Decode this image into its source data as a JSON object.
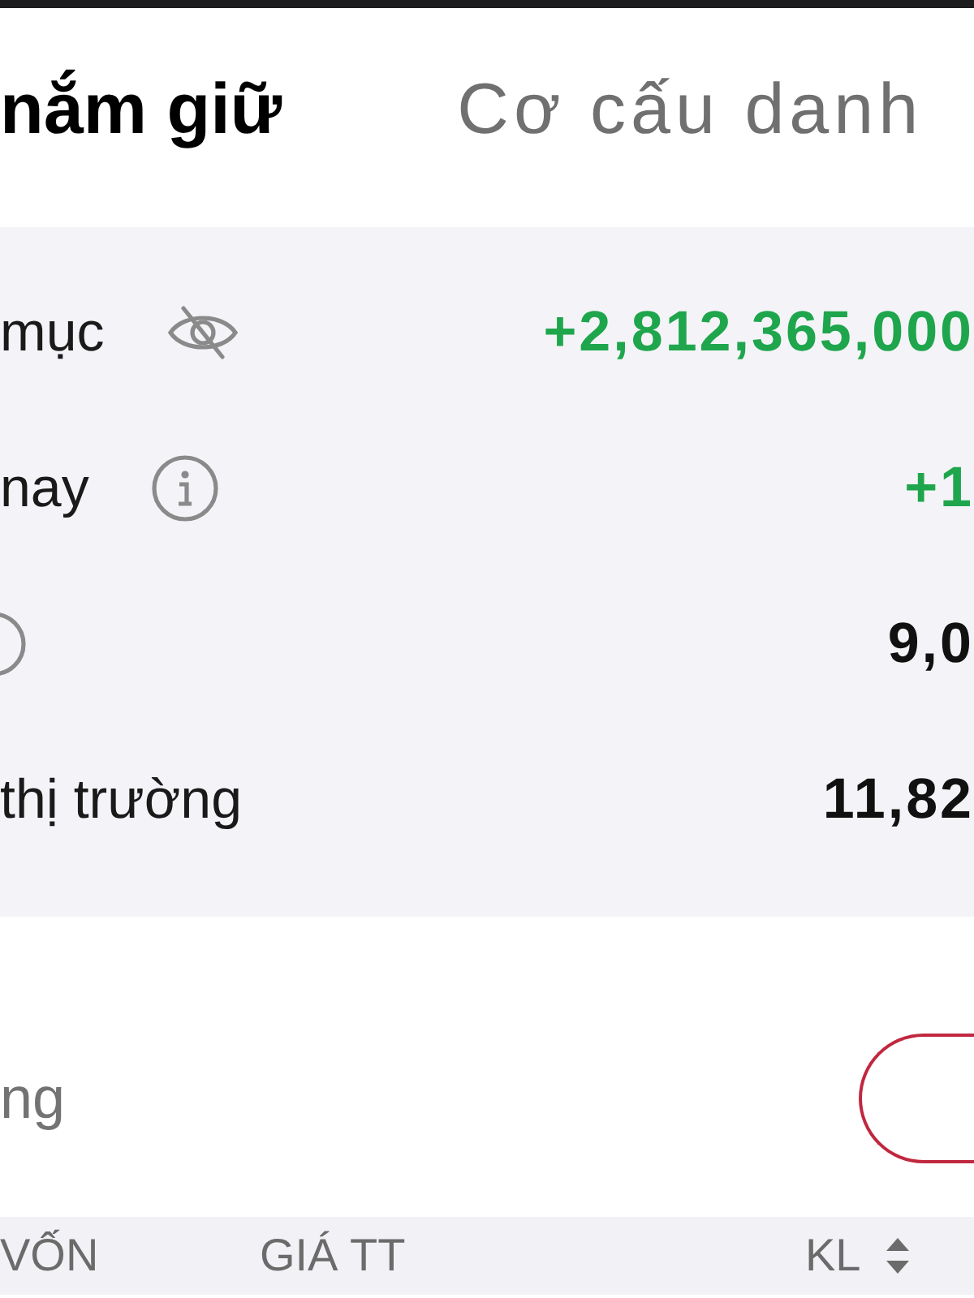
{
  "tabs": [
    {
      "label": "nắm giữ",
      "selected": true
    },
    {
      "label": "Cơ cấu danh",
      "selected": false
    }
  ],
  "summary": {
    "rows": [
      {
        "kind": "visibility",
        "label": "mục",
        "value": "+2,812,365,000",
        "color": "#1fa64d"
      },
      {
        "kind": "info",
        "label": "nay",
        "value": "+1",
        "color": "#1fa64d"
      },
      {
        "kind": "edge-info",
        "value": "9,0",
        "color": "#111111"
      },
      {
        "kind": "plain",
        "label": "thị trường",
        "value": "11,82",
        "color": "#111111"
      }
    ]
  },
  "holdings": {
    "title": "ng"
  },
  "table": {
    "columns": [
      {
        "label": "VỐN",
        "sortable": false
      },
      {
        "label": "GIÁ TT",
        "sortable": false
      },
      {
        "label": "KL",
        "sortable": true
      }
    ]
  }
}
